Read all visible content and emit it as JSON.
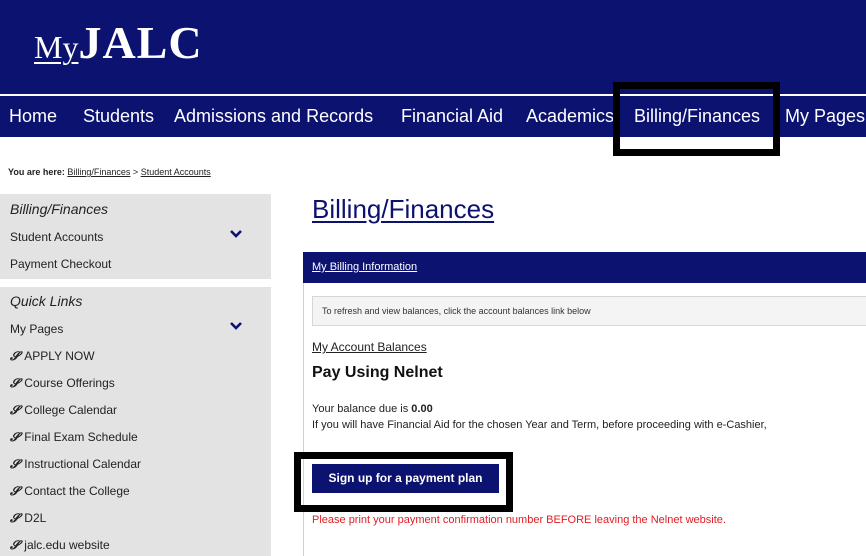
{
  "header": {
    "logo_my": "My",
    "logo_name": "JALC"
  },
  "nav": {
    "items": [
      "Home",
      "Students",
      "Admissions and Records",
      "Financial Aid",
      "Academics",
      "Billing/Finances",
      "My Pages"
    ]
  },
  "breadcrumb": {
    "label": "You are here:",
    "crumb1": "Billing/Finances",
    "separator": ">",
    "crumb2": "Student Accounts"
  },
  "sidebar": {
    "section1_title": "Billing/Finances",
    "section1_items": [
      "Student Accounts",
      "Payment Checkout"
    ],
    "section2_title": "Quick Links",
    "my_pages": "My Pages",
    "links": [
      "APPLY NOW",
      "Course Offerings",
      "College Calendar",
      "Final Exam Schedule",
      "Instructional Calendar",
      "Contact the College",
      "D2L",
      "jalc.edu website"
    ],
    "link_icon": "chain-link-icon",
    "expand_icon": "chevron-down-icon"
  },
  "main": {
    "title": "Billing/Finances",
    "panel_heading": "My Billing Information",
    "notice": "To refresh and view balances, click the account balances link below",
    "account_balances_link": "My Account Balances",
    "pay_title": "Pay Using Nelnet",
    "balance_prefix": "Your balance due is",
    "balance_value": "0.00",
    "aid_text": "If you will have Financial Aid for the chosen Year and Term, before proceeding with e-Cashier,",
    "payment_plan_button": "Sign up for a payment plan",
    "warning": "Please print your payment confirmation number BEFORE leaving the Nelnet website."
  },
  "colors": {
    "brand": "#0c1270",
    "warning": "#e01d25",
    "sidebar_bg": "#e3e3e3"
  }
}
